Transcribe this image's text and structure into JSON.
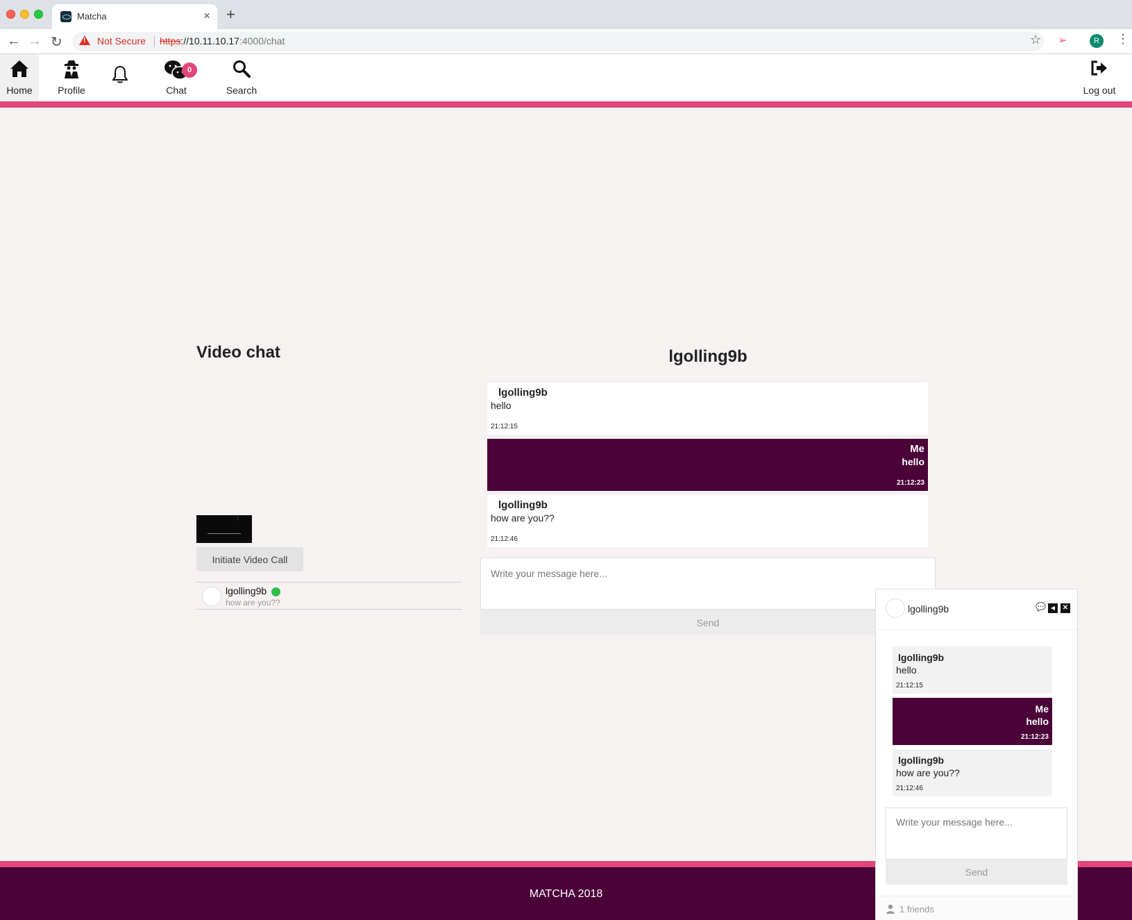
{
  "browser": {
    "tab_title": "Matcha",
    "tab_close": "×",
    "new_tab": "+",
    "security_label": "Not Secure",
    "url_protocol": "https",
    "url_host": "://10.11.10.17",
    "url_rest": ":4000/chat",
    "profile_initial": "R"
  },
  "nav": {
    "home": "Home",
    "profile": "Profile",
    "chat": "Chat",
    "chat_badge": "0",
    "search": "Search",
    "logout": "Log out"
  },
  "video": {
    "title": "Video chat",
    "button": "Initiate Video Call"
  },
  "contacts": [
    {
      "name": "lgolling9b",
      "last_message": "how are you??",
      "online": true
    }
  ],
  "chat": {
    "header": "lgolling9b",
    "messages": [
      {
        "sender": "lgolling9b",
        "text": "hello",
        "time": "21:12:15",
        "mine": false
      },
      {
        "sender": "Me",
        "text": "hello",
        "time": "21:12:23",
        "mine": true
      },
      {
        "sender": "lgolling9b",
        "text": "how are you??",
        "time": "21:12:46",
        "mine": false
      }
    ],
    "input_placeholder": "Write your message here...",
    "send_label": "Send"
  },
  "widget": {
    "name": "lgolling9b",
    "messages": [
      {
        "sender": "lgolling9b",
        "text": "hello",
        "time": "21:12:15",
        "mine": false
      },
      {
        "sender": "Me",
        "text": "hello",
        "time": "21:12:23",
        "mine": true
      },
      {
        "sender": "lgolling9b",
        "text": "how are you??",
        "time": "21:12:46",
        "mine": false
      }
    ],
    "input_placeholder": "Write your message here...",
    "send_label": "Send",
    "friends_label": "1 friends"
  },
  "footer": {
    "text": "MATCHA 2018"
  },
  "colors": {
    "accent_pink": "#e0457b",
    "brand_purple": "#4a0238",
    "online_green": "#2cbe4e"
  }
}
